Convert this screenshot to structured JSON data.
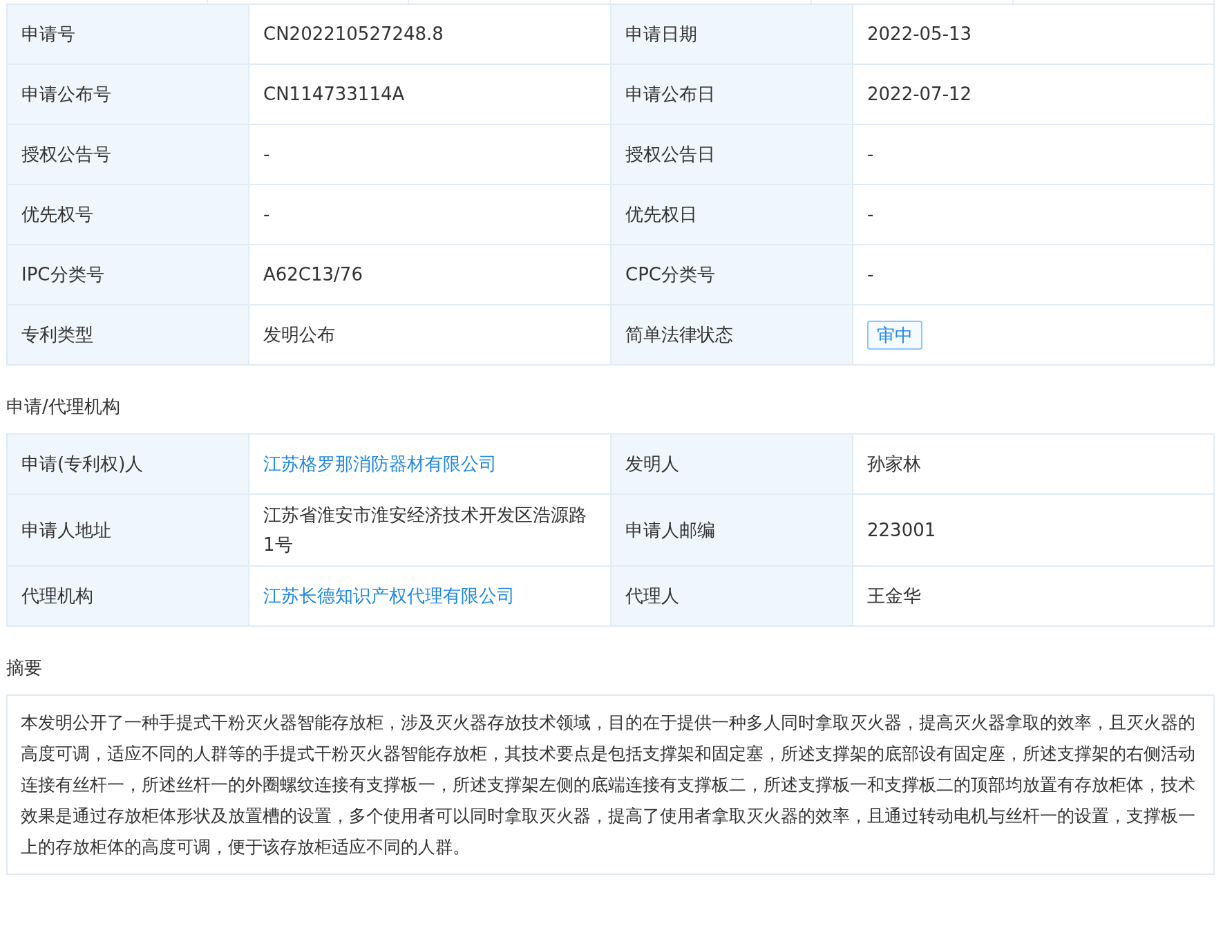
{
  "basic_info": {
    "rows": [
      [
        {
          "label": "申请号",
          "value": "CN202210527248.8",
          "kind": "text"
        },
        {
          "label": "申请日期",
          "value": "2022-05-13",
          "kind": "text"
        }
      ],
      [
        {
          "label": "申请公布号",
          "value": "CN114733114A",
          "kind": "text"
        },
        {
          "label": "申请公布日",
          "value": "2022-07-12",
          "kind": "text"
        }
      ],
      [
        {
          "label": "授权公告号",
          "value": "-",
          "kind": "text"
        },
        {
          "label": "授权公告日",
          "value": "-",
          "kind": "text"
        }
      ],
      [
        {
          "label": "优先权号",
          "value": "-",
          "kind": "text"
        },
        {
          "label": "优先权日",
          "value": "-",
          "kind": "text"
        }
      ],
      [
        {
          "label": "IPC分类号",
          "value": "A62C13/76",
          "kind": "text"
        },
        {
          "label": "CPC分类号",
          "value": "-",
          "kind": "text"
        }
      ],
      [
        {
          "label": "专利类型",
          "value": "发明公布",
          "kind": "text"
        },
        {
          "label": "简单法律状态",
          "value": "审中",
          "kind": "tag"
        }
      ]
    ]
  },
  "agency": {
    "title": "申请/代理机构",
    "rows": [
      [
        {
          "label": "申请(专利权)人",
          "value": "江苏格罗那消防器材有限公司",
          "kind": "link"
        },
        {
          "label": "发明人",
          "value": "孙家林",
          "kind": "text"
        }
      ],
      [
        {
          "label": "申请人地址",
          "value": "江苏省淮安市淮安经济技术开发区浩源路1号",
          "kind": "text"
        },
        {
          "label": "申请人邮编",
          "value": "223001",
          "kind": "text"
        }
      ],
      [
        {
          "label": "代理机构",
          "value": "江苏长德知识产权代理有限公司",
          "kind": "link"
        },
        {
          "label": "代理人",
          "value": "王金华",
          "kind": "text"
        }
      ]
    ]
  },
  "abstract": {
    "title": "摘要",
    "text": "本发明公开了一种手提式干粉灭火器智能存放柜，涉及灭火器存放技术领域，目的在于提供一种多人同时拿取灭火器，提高灭火器拿取的效率，且灭火器的高度可调，适应不同的人群等的手提式干粉灭火器智能存放柜，其技术要点是包括支撑架和固定塞，所述支撑架的底部设有固定座，所述支撑架的右侧活动连接有丝杆一，所述丝杆一的外圈螺纹连接有支撑板一，所述支撑架左侧的底端连接有支撑板二，所述支撑板一和支撑板二的顶部均放置有存放柜体，技术效果是通过存放柜体形状及放置槽的设置，多个使用者可以同时拿取灭火器，提高了使用者拿取灭火器的效率，且通过转动电机与丝杆一的设置，支撑板一上的存放柜体的高度可调，便于该存放柜适应不同的人群。"
  }
}
